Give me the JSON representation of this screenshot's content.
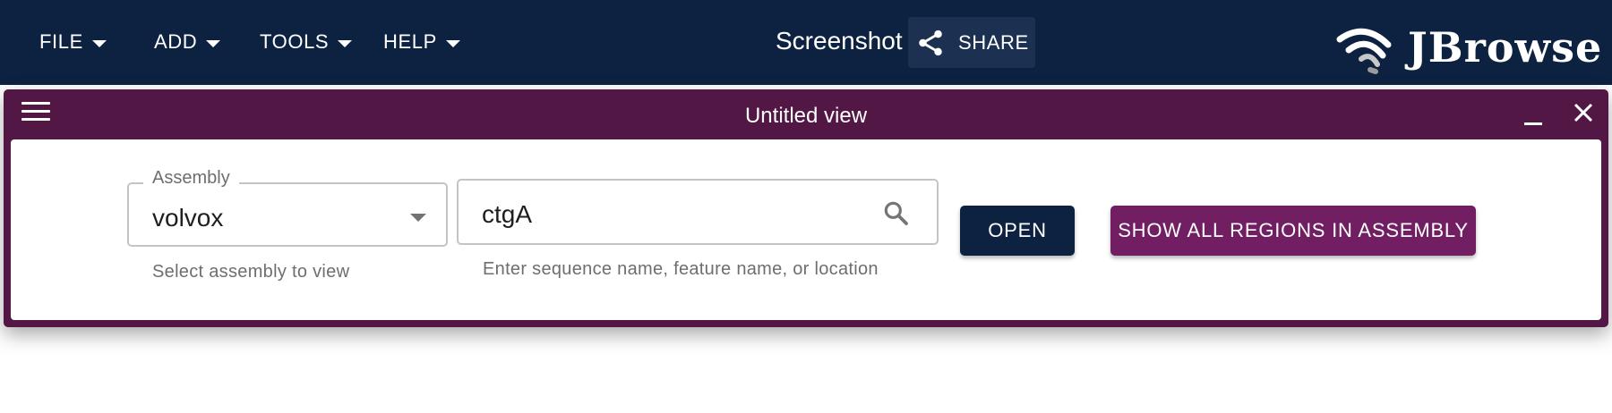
{
  "appbar": {
    "menus": [
      {
        "label": "FILE"
      },
      {
        "label": "ADD"
      },
      {
        "label": "TOOLS"
      },
      {
        "label": "HELP"
      }
    ],
    "session_name": "Screenshot",
    "share_label": "SHARE",
    "logo_text": "JBrowse",
    "background_color": "#0d2240"
  },
  "view": {
    "title": "Untitled view",
    "header_color": "#531745",
    "assembly": {
      "label": "Assembly",
      "value": "volvox",
      "helper": "Select assembly to view"
    },
    "search": {
      "value": "ctgA",
      "helper": "Enter sequence name, feature name, or location"
    },
    "open_label": "OPEN",
    "show_all_label": "SHOW ALL REGIONS IN ASSEMBLY",
    "accent_color": "#721e63"
  },
  "icons": [
    "menu-caret-icon",
    "share-icon",
    "jbrowse-logo-icon",
    "hamburger-menu-icon",
    "minimize-icon",
    "close-icon",
    "dropdown-caret-icon",
    "search-icon"
  ]
}
